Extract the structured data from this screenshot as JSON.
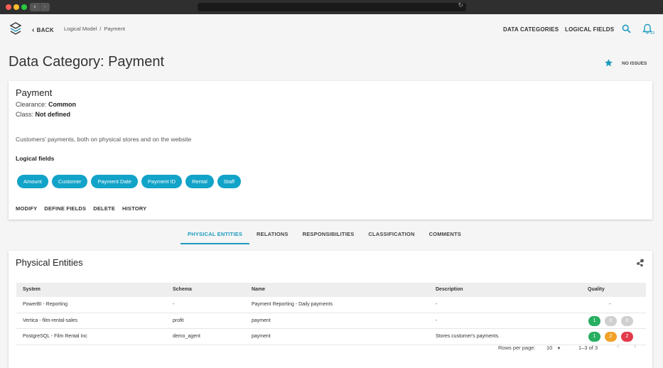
{
  "browser": {
    "traffic_lights": [
      "#ff5f57",
      "#febc2e",
      "#28c840"
    ],
    "back_arrow": "‹",
    "forward_arrow": "›",
    "reload_icon": "↻"
  },
  "topnav": {
    "back_label": "BACK",
    "breadcrumb": [
      "Logical Model",
      "Payment"
    ],
    "breadcrumb_sep": "/",
    "links": [
      "DATA CATEGORIES",
      "LOGICAL FIELDS"
    ],
    "notification_count": "13"
  },
  "page": {
    "title": "Data Category: Payment",
    "status": "NO ISSUES"
  },
  "category": {
    "name": "Payment",
    "clearance_label": "Clearance:",
    "clearance_value": "Common",
    "class_label": "Class:",
    "class_value": "Not defined",
    "description": "Customers’ payments, both on physical stores and on the website",
    "logical_fields_heading": "Logical fields",
    "logical_fields": [
      "Amount",
      "Customer",
      "Payment Date",
      "Payment ID",
      "Rental",
      "Staff"
    ],
    "actions": [
      "MODIFY",
      "DEFINE FIELDS",
      "DELETE",
      "HISTORY"
    ]
  },
  "tabs": {
    "items": [
      "PHYSICAL ENTITIES",
      "RELATIONS",
      "RESPONSIBILITIES",
      "CLASSIFICATION",
      "COMMENTS"
    ],
    "active": "PHYSICAL ENTITIES"
  },
  "physical_entities": {
    "title": "Physical Entities",
    "columns": [
      "System",
      "Schema",
      "Name",
      "Description",
      "Quality"
    ],
    "rows": [
      {
        "system": "PowerBI - Reporting",
        "schema": "-",
        "name": "Payment Reporting - Daily payments",
        "description": "-",
        "quality_text": "-",
        "quality": []
      },
      {
        "system": "Vertica - film-rental-sales",
        "schema": "profit",
        "name": "payment",
        "description": "-",
        "quality_text": "",
        "quality": [
          {
            "value": "1",
            "color": "#27ae60"
          },
          {
            "value": "0",
            "color": "#cfcfcf"
          },
          {
            "value": "0",
            "color": "#cfcfcf"
          }
        ]
      },
      {
        "system": "PostgreSQL - Film Rental Inc",
        "schema": "demo_agent",
        "name": "payment",
        "description": "Stores customer's payments.",
        "quality_text": "",
        "quality": [
          {
            "value": "1",
            "color": "#27ae60"
          },
          {
            "value": "2",
            "color": "#f0a229"
          },
          {
            "value": "2",
            "color": "#e23a4b"
          }
        ]
      }
    ],
    "pagination": {
      "rows_per_page_label": "Rows per page:",
      "rows_per_page_value": "10",
      "range": "1–3 of 3"
    }
  },
  "colors": {
    "accent": "#1e9bbf",
    "chip": "#12a3c8"
  }
}
